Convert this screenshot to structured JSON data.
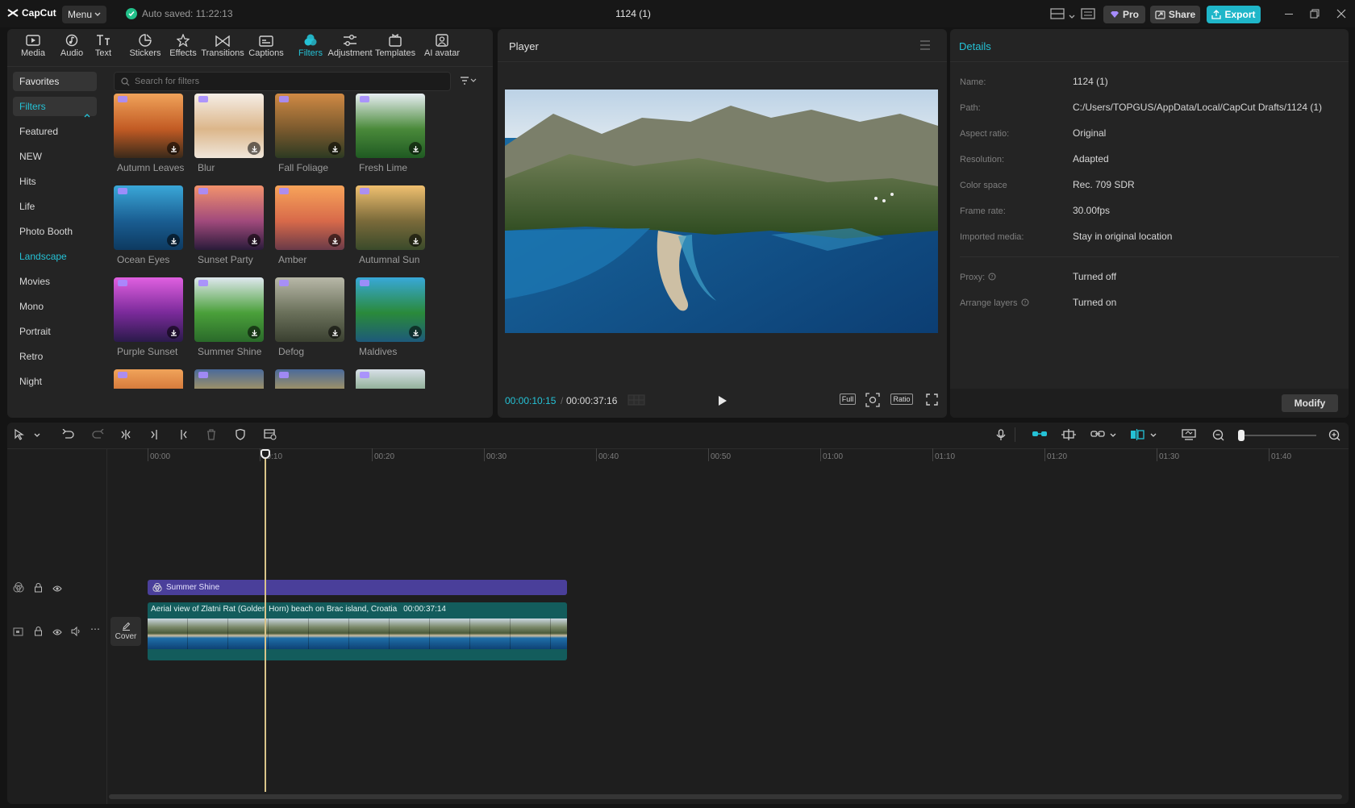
{
  "titlebar": {
    "logo": "CapCut",
    "menu": "Menu",
    "autosave": "Auto saved: 11:22:13",
    "project_title": "1124 (1)",
    "pro": "Pro",
    "share": "Share",
    "export": "Export"
  },
  "toolbar": [
    {
      "label": "Media",
      "icon": "media-icon"
    },
    {
      "label": "Audio",
      "icon": "audio-icon"
    },
    {
      "label": "Text",
      "icon": "text-icon"
    },
    {
      "label": "Stickers",
      "icon": "stickers-icon"
    },
    {
      "label": "Effects",
      "icon": "effects-icon"
    },
    {
      "label": "Transitions",
      "icon": "transitions-icon"
    },
    {
      "label": "Captions",
      "icon": "captions-icon"
    },
    {
      "label": "Filters",
      "icon": "filters-icon",
      "active": true
    },
    {
      "label": "Adjustment",
      "icon": "adjustment-icon"
    },
    {
      "label": "Templates",
      "icon": "templates-icon"
    },
    {
      "label": "AI avatar",
      "icon": "ai-avatar-icon"
    }
  ],
  "categories": [
    "Favorites",
    "Filters",
    "Featured",
    "NEW",
    "Hits",
    "Life",
    "Photo Booth",
    "Landscape",
    "Movies",
    "Mono",
    "Portrait",
    "Retro",
    "Night"
  ],
  "search": {
    "placeholder": "Search for filters"
  },
  "filters": [
    {
      "label": "Autumn Leaves"
    },
    {
      "label": "Blur"
    },
    {
      "label": "Fall Foliage"
    },
    {
      "label": "Fresh Lime"
    },
    {
      "label": "Ocean Eyes"
    },
    {
      "label": "Sunset Party"
    },
    {
      "label": "Amber"
    },
    {
      "label": "Autumnal Sun"
    },
    {
      "label": "Purple Sunset"
    },
    {
      "label": "Summer Shine"
    },
    {
      "label": "Defog"
    },
    {
      "label": "Maldives"
    },
    {
      "label": ""
    },
    {
      "label": ""
    },
    {
      "label": ""
    },
    {
      "label": ""
    }
  ],
  "player": {
    "title": "Player",
    "current_time": "00:00:10:15",
    "separator": "/",
    "total_time": "00:00:37:16",
    "full": "Full",
    "ratio": "Ratio"
  },
  "details": {
    "title": "Details",
    "rows": [
      {
        "key": "Name:",
        "value": "1124 (1)"
      },
      {
        "key": "Path:",
        "value": "C:/Users/TOPGUS/AppData/Local/CapCut Drafts/1124 (1)"
      },
      {
        "key": "Aspect ratio:",
        "value": "Original"
      },
      {
        "key": "Resolution:",
        "value": "Adapted"
      },
      {
        "key": "Color space",
        "value": "Rec. 709 SDR"
      },
      {
        "key": "Frame rate:",
        "value": "30.00fps"
      },
      {
        "key": "Imported media:",
        "value": "Stay in original location"
      },
      {
        "key": "Proxy:",
        "value": "Turned off"
      },
      {
        "key": "Arrange layers",
        "value": "Turned on"
      }
    ],
    "modify": "Modify"
  },
  "timeline": {
    "ticks": [
      "00:00",
      "00:10",
      "00:20",
      "00:30",
      "00:40",
      "00:50",
      "01:00",
      "01:10",
      "01:20",
      "01:30",
      "01:40"
    ],
    "filter_clip": "Summer Shine",
    "video_clip": "Aerial view of Zlatni Rat (Golden Horn) beach on Brac island, Croatia",
    "video_duration": "00:00:37:14",
    "cover": "Cover"
  },
  "colors": {
    "accent": "#25c2d6",
    "filter_clip": "#4a3f9a",
    "video_clip": "#135c5c",
    "playhead": "#d9c48a"
  }
}
